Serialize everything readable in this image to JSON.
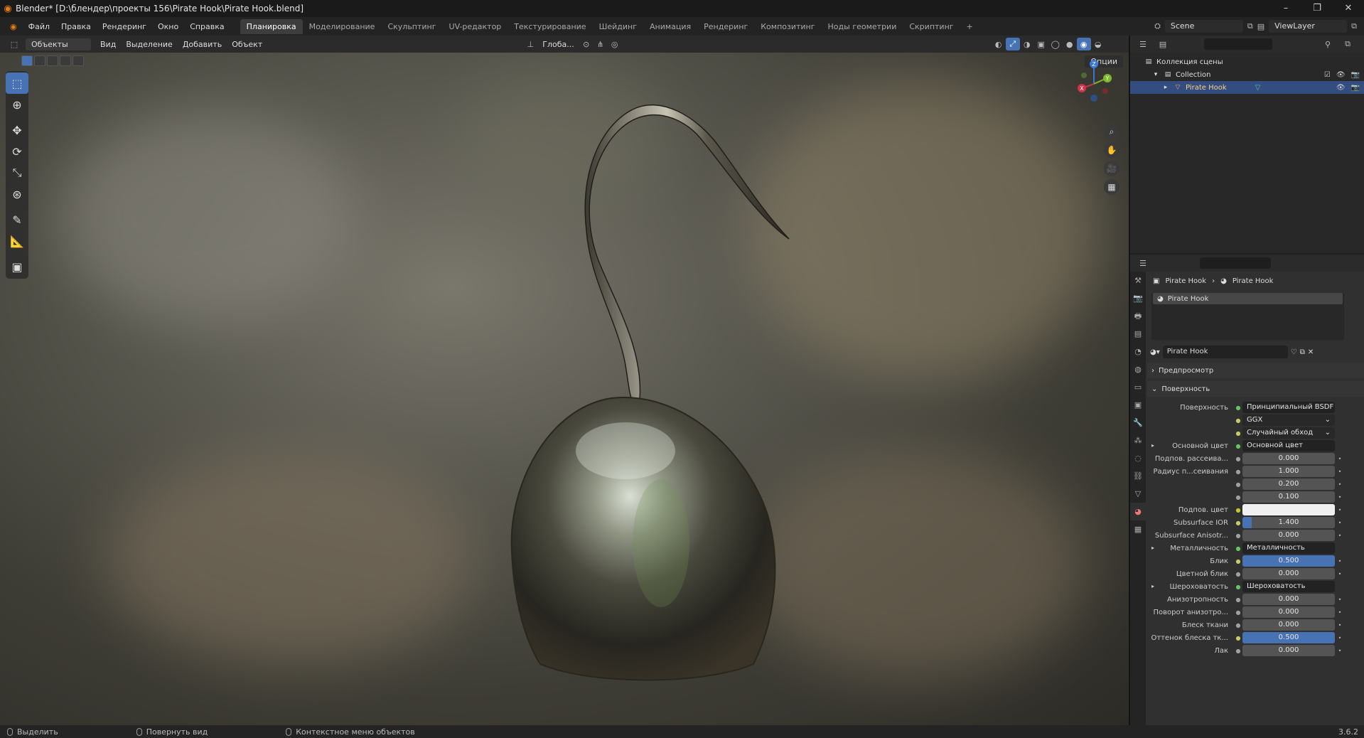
{
  "window": {
    "title": "Blender* [D:\\блендер\\проекты 156\\Pirate Hook\\Pirate Hook.blend]",
    "minimize": "–",
    "maximize": "❐",
    "close": "✕"
  },
  "menu": [
    "Файл",
    "Правка",
    "Рендеринг",
    "Окно",
    "Справка"
  ],
  "workspaces": [
    "Планировка",
    "Моделирование",
    "Скульптинг",
    "UV-редактор",
    "Текстурирование",
    "Шейдинг",
    "Анимация",
    "Рендеринг",
    "Композитинг",
    "Ноды геометрии",
    "Скриптинг",
    "+"
  ],
  "scene": {
    "name": "Scene",
    "view_layer": "ViewLayer"
  },
  "viewport_header": {
    "mode": "Объекты",
    "menus": [
      "Вид",
      "Выделение",
      "Добавить",
      "Объект"
    ],
    "orientation": "Глоба...",
    "options": "Опции"
  },
  "gizmo": {
    "z": "Z",
    "y": "Y",
    "x": "X"
  },
  "outliner": {
    "root": "Коллекция сцены",
    "collection": "Collection",
    "object": "Pirate Hook"
  },
  "properties": {
    "breadcrumb_object": "Pirate Hook",
    "breadcrumb_material": "Pirate Hook",
    "slot": "Pirate Hook",
    "material_name": "Pirate Hook",
    "sections": {
      "preview": "Предпросмотр",
      "surface": "Поверхность"
    },
    "rows": [
      {
        "label": "Поверхность",
        "value": "Принципиальный BSDF",
        "kind": "link",
        "tri": false
      },
      {
        "label": "",
        "value": "GGX",
        "kind": "select",
        "tri": false
      },
      {
        "label": "",
        "value": "Случайный обход",
        "kind": "select",
        "tri": false
      },
      {
        "label": "Основной цвет",
        "value": "Основной цвет",
        "kind": "link",
        "tri": true
      },
      {
        "label": "Подпов. рассеива...",
        "value": "0.000",
        "kind": "num",
        "tri": false
      },
      {
        "label": "Радиус п...сеивания",
        "value": "1.000",
        "kind": "num",
        "tri": false
      },
      {
        "label": "",
        "value": "0.200",
        "kind": "num",
        "tri": false
      },
      {
        "label": "",
        "value": "0.100",
        "kind": "num",
        "tri": false
      },
      {
        "label": "Подпов. цвет",
        "value": "",
        "kind": "white",
        "tri": false
      },
      {
        "label": "Subsurface IOR",
        "value": "1.400",
        "kind": "num",
        "fill": 0.1,
        "tri": false
      },
      {
        "label": "Subsurface Anisotr...",
        "value": "0.000",
        "kind": "num",
        "tri": false
      },
      {
        "label": "Металличность",
        "value": "Металличность",
        "kind": "link",
        "tri": true
      },
      {
        "label": "Блик",
        "value": "0.500",
        "kind": "num",
        "fill": 1.0,
        "tri": false
      },
      {
        "label": "Цветной блик",
        "value": "0.000",
        "kind": "num",
        "tri": false
      },
      {
        "label": "Шероховатость",
        "value": "Шероховатость",
        "kind": "link",
        "tri": true
      },
      {
        "label": "Анизотропность",
        "value": "0.000",
        "kind": "num",
        "tri": false
      },
      {
        "label": "Поворот анизотро...",
        "value": "0.000",
        "kind": "num",
        "tri": false
      },
      {
        "label": "Блеск ткани",
        "value": "0.000",
        "kind": "num",
        "tri": false
      },
      {
        "label": "Оттенок блеска тк...",
        "value": "0.500",
        "kind": "num",
        "fill": 1.0,
        "tri": false
      },
      {
        "label": "Лак",
        "value": "0.000",
        "kind": "num",
        "tri": false
      }
    ]
  },
  "status": {
    "select": "Выделить",
    "rotate": "Повернуть вид",
    "context": "Контекстное меню объектов",
    "version": "3.6.2"
  },
  "colors": {
    "accent": "#4772b3",
    "selection": "#334d80",
    "orange": "#e87d0d"
  }
}
